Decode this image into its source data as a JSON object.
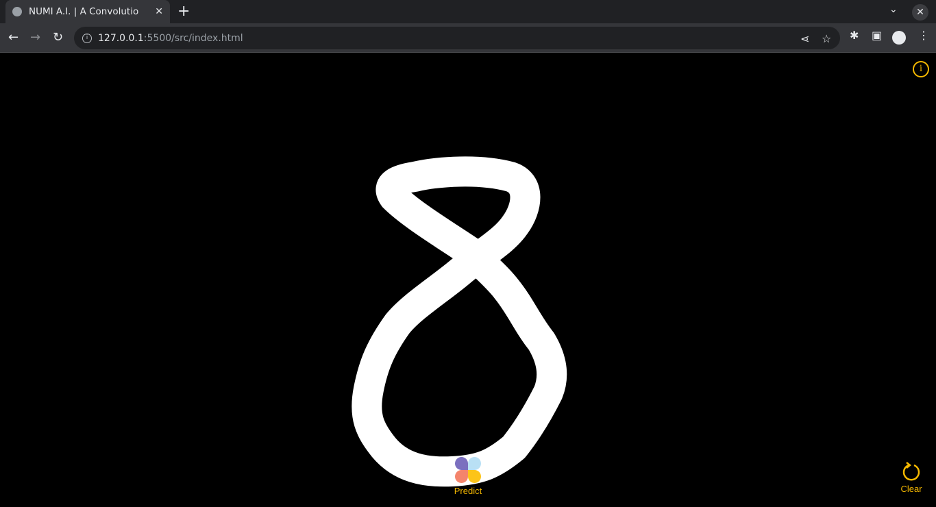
{
  "browser": {
    "tab_title": "NUMI A.I. | A Convolutio",
    "new_tab": "+",
    "url_host": "127.0.0.1",
    "url_path": ":5500/src/index.html"
  },
  "app": {
    "info_label": "i",
    "predict_label": "Predict",
    "clear_label": "Clear",
    "accent": "#f5b800"
  }
}
